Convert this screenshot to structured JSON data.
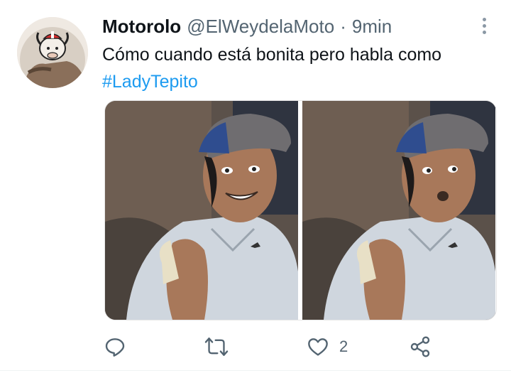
{
  "tweet": {
    "display_name": "Motorolo",
    "handle": "@ElWeydelaMoto",
    "separator": "·",
    "time": "9min",
    "text": "Cómo cuando está bonita pero habla como",
    "hashtag": "#LadyTepito",
    "media": {
      "image_count": 2,
      "images": [
        {
          "expression": "smiling"
        },
        {
          "expression": "surprised"
        }
      ]
    },
    "actions": {
      "reply_icon": "reply-icon",
      "retweet_icon": "retweet-icon",
      "like_icon": "heart-icon",
      "like_count": "2",
      "share_icon": "share-icon"
    }
  },
  "colors": {
    "link": "#1d9bf0",
    "secondary_text": "#536471",
    "primary_text": "#0f1419",
    "icon": "#536471"
  }
}
